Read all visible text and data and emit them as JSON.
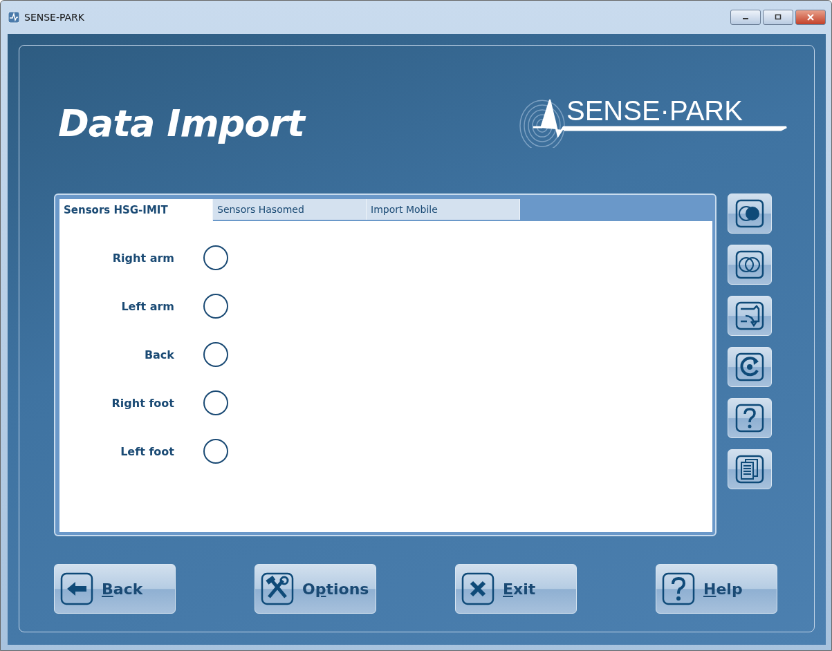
{
  "window": {
    "title": "SENSE-PARK"
  },
  "heading": "Data Import",
  "logo": {
    "text": "SENSE·PARK"
  },
  "tabs": [
    {
      "label": "Sensors HSG-IMIT",
      "selected": true
    },
    {
      "label": "Sensors Hasomed",
      "selected": false
    },
    {
      "label": "Import Mobile",
      "selected": false
    }
  ],
  "sensors": [
    {
      "name": "Right arm",
      "connected": false
    },
    {
      "name": "Left arm",
      "connected": false
    },
    {
      "name": "Back",
      "connected": false
    },
    {
      "name": "Right foot",
      "connected": false
    },
    {
      "name": "Left foot",
      "connected": false
    }
  ],
  "side_buttons": [
    {
      "kind": "circle-filled"
    },
    {
      "kind": "circle-outline"
    },
    {
      "kind": "import"
    },
    {
      "kind": "refresh"
    },
    {
      "kind": "help"
    },
    {
      "kind": "documents"
    }
  ],
  "buttons": [
    {
      "kind": "back",
      "key": "B",
      "after": "ack"
    },
    {
      "kind": "options",
      "before": "O",
      "key": "p",
      "after": "tions"
    },
    {
      "kind": "exit",
      "key": "E",
      "after": "xit"
    },
    {
      "kind": "help",
      "key": "H",
      "after": "elp"
    }
  ]
}
